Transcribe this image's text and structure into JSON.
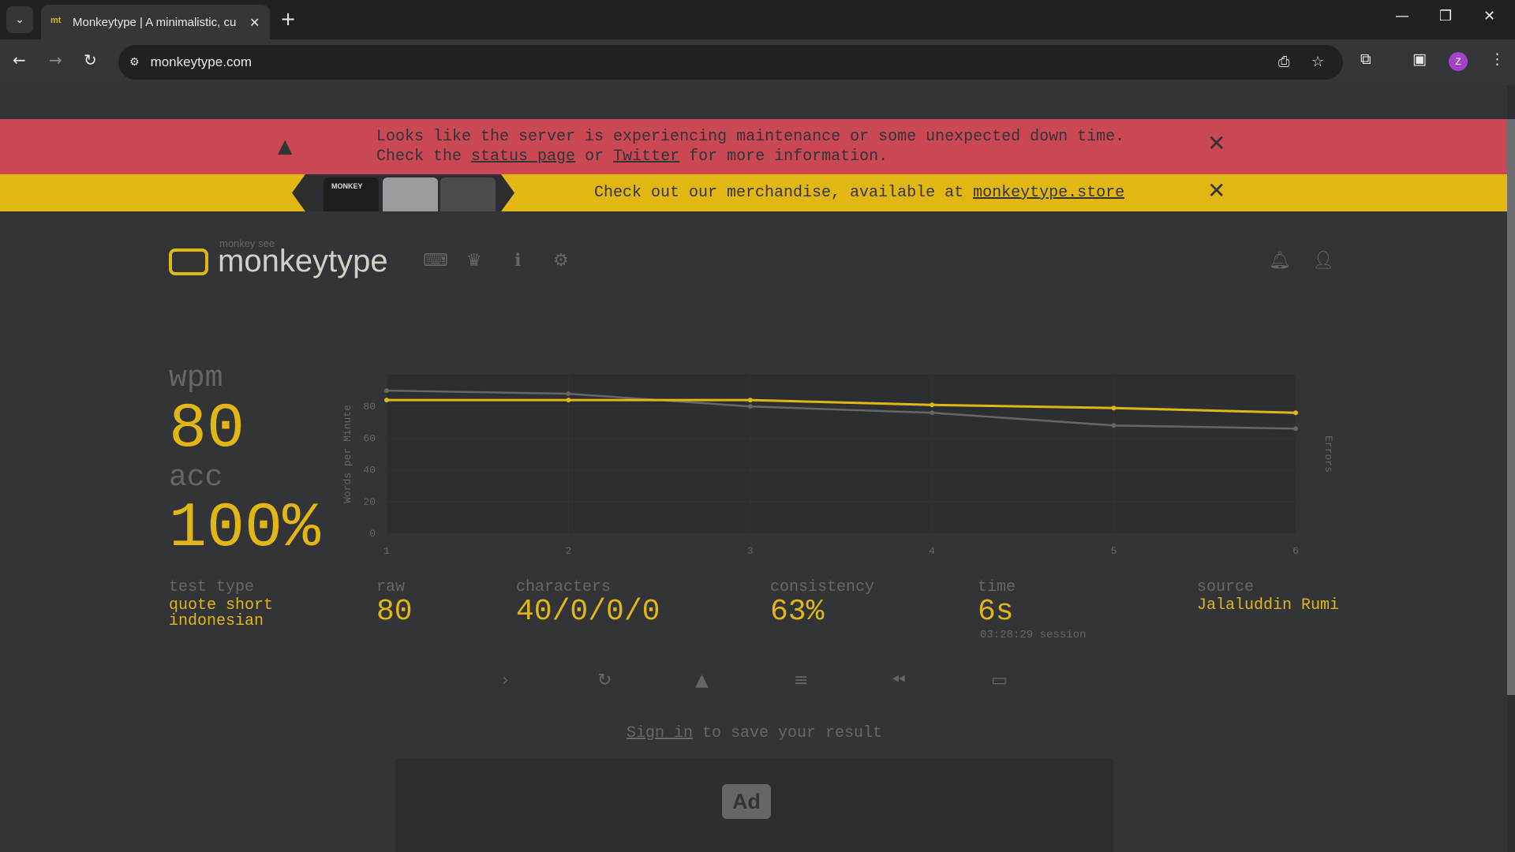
{
  "browser": {
    "tab_title": "Monkeytype | A minimalistic, cu",
    "favicon": "mt",
    "url": "monkeytype.com",
    "profile_initial": "Z"
  },
  "banners": {
    "maintenance_line1": "Looks like the server is experiencing maintenance or some unexpected down time.",
    "maintenance_line2_pre": "Check the ",
    "maintenance_link1": "status page",
    "maintenance_mid": " or ",
    "maintenance_link2": "Twitter",
    "maintenance_post": " for more information.",
    "merch_pre": "Check out our merchandise, available at ",
    "merch_link": "monkeytype.store",
    "merch_shirt_label": "MONKEY"
  },
  "header": {
    "logo_sub": "monkey see",
    "logo_text": "monkeytype"
  },
  "result": {
    "wpm_label": "wpm",
    "wpm_value": "80",
    "acc_label": "acc",
    "acc_value": "100%",
    "test_type_label": "test type",
    "test_type_line1": "quote short",
    "test_type_line2": "indonesian",
    "raw_label": "raw",
    "raw_value": "80",
    "characters_label": "characters",
    "characters_value": "40/0/0/0",
    "consistency_label": "consistency",
    "consistency_value": "63%",
    "time_label": "time",
    "time_value": "6s",
    "time_session": "03:28:29 session",
    "source_label": "source",
    "source_value": "Jalaluddin Rumi"
  },
  "chart_data": {
    "type": "line",
    "x": [
      1,
      2,
      3,
      4,
      5,
      6
    ],
    "series": [
      {
        "values": [
          84,
          84,
          84,
          81,
          79,
          76
        ],
        "color": "#e2b714"
      },
      {
        "values": [
          90,
          88,
          80,
          76,
          68,
          66
        ],
        "color": "#646669"
      }
    ],
    "ylabel": "Words per Minute",
    "y2label": "Errors",
    "yticks": [
      "0",
      "20",
      "40",
      "60",
      "80"
    ],
    "xticks": [
      "1",
      "2",
      "3",
      "4",
      "5",
      "6"
    ],
    "ylim": [
      0,
      100
    ],
    "grid": true
  },
  "footer": {
    "sign_in_link": "Sign in",
    "sign_in_rest": " to save your result",
    "ad_label": "Ad"
  },
  "colors": {
    "bg": "#323437",
    "main": "#e2b714",
    "sub": "#646669",
    "error": "#ca4754"
  }
}
